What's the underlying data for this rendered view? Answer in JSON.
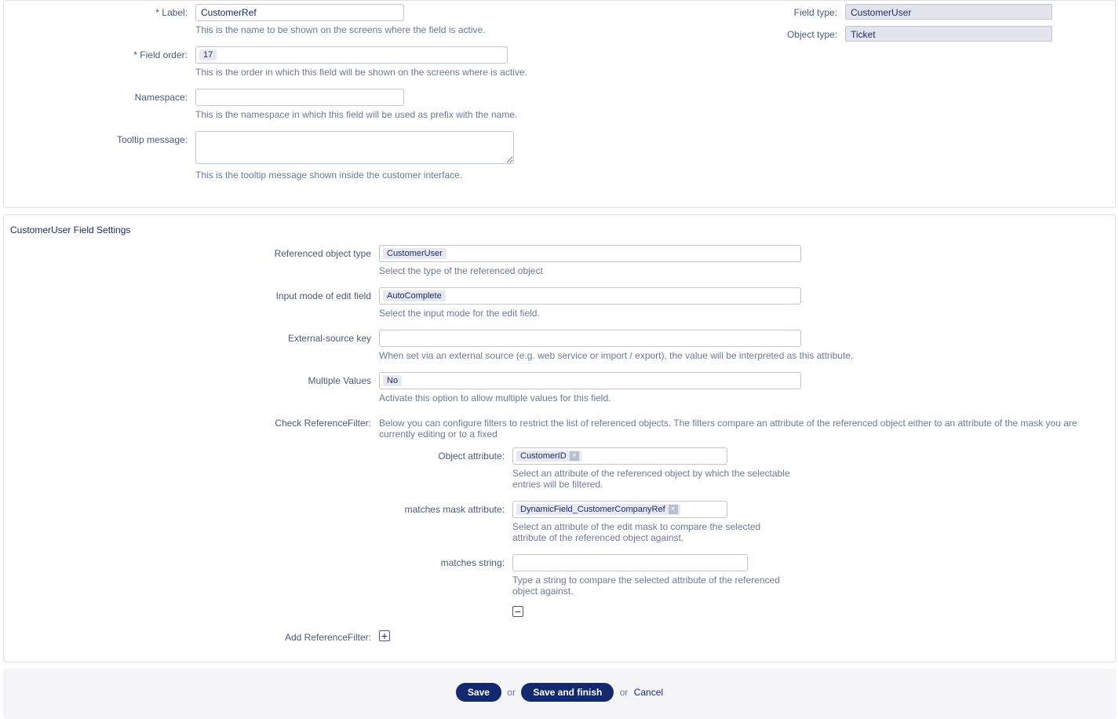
{
  "general": {
    "label_label": "Label:",
    "label_value": "CustomerRef",
    "label_help": "This is the name to be shown on the screens where the field is active.",
    "fieldorder_label": "Field order:",
    "fieldorder_value": "17",
    "fieldorder_help": "This is the order in which this field will be shown on the screens where is active.",
    "namespace_label": "Namespace:",
    "namespace_value": "",
    "namespace_help": "This is the namespace in which this field will be used as prefix with the name.",
    "tooltip_label": "Tooltip message:",
    "tooltip_value": "",
    "tooltip_help": "This is the tooltip message shown inside the customer interface.",
    "fieldtype_label": "Field type:",
    "fieldtype_value": "CustomerUser",
    "objecttype_label": "Object type:",
    "objecttype_value": "Ticket"
  },
  "settings": {
    "title": "CustomerUser Field Settings",
    "refobj_label": "Referenced object type",
    "refobj_value": "CustomerUser",
    "refobj_help": "Select the type of the referenced object",
    "inputmode_label": "Input mode of edit field",
    "inputmode_value": "AutoComplete",
    "inputmode_help": "Select the input mode for the edit field.",
    "extkey_label": "External-source key",
    "extkey_value": "",
    "extkey_help": "When set via an external source (e.g. web service or import / export), the value will be interpreted as this attribute.",
    "multival_label": "Multiple Values",
    "multival_value": "No",
    "multival_help": "Activate this option to allow multiple values for this field.",
    "checkfilter_label": "Check ReferenceFilter:",
    "checkfilter_text": "Below you can configure filters to restrict the list of referenced objects. The filters compare an attribute of the referenced object either to an attribute of the mask you are currently editing or to a fixed",
    "objattr_label": "Object attribute:",
    "objattr_value": "CustomerID",
    "objattr_help": "Select an attribute of the referenced object by which the selectable entries will be filtered.",
    "maskattr_label": "matches mask attribute:",
    "maskattr_value": "DynamicField_CustomerCompanyRef",
    "maskattr_help": "Select an attribute of the edit mask to compare the selected attribute of the referenced object against.",
    "matchstr_label": "matches string:",
    "matchstr_value": "",
    "matchstr_help": "Type a string to compare the selected attribute of the referenced object against.",
    "addfilter_label": "Add ReferenceFilter:"
  },
  "footer": {
    "save": "Save",
    "or1": "or",
    "save_finish": "Save and finish",
    "or2": "or",
    "cancel": "Cancel"
  }
}
